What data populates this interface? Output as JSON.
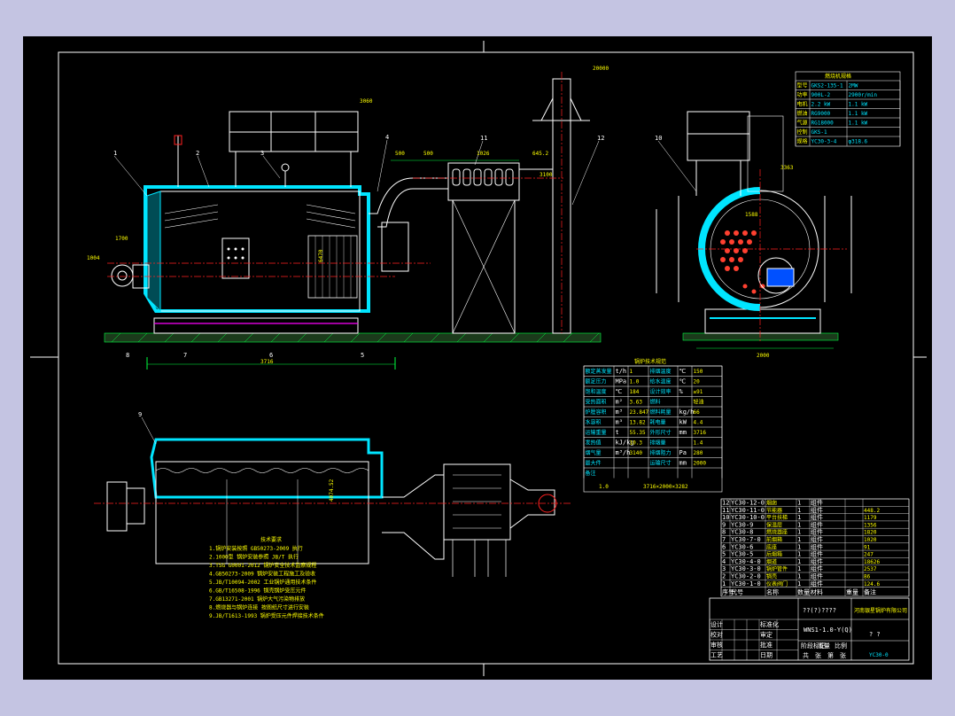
{
  "drawing": {
    "code": "YC30-0",
    "model": "WNS1-1.0-Y(Q)",
    "title_marks": "??(?)????",
    "placeholder_marks": "? ?",
    "company": "河南银星锅炉有限公司"
  },
  "balloons": [
    "1",
    "2",
    "3",
    "4",
    "5",
    "6",
    "7",
    "8",
    "9",
    "10",
    "11",
    "12"
  ],
  "dimensions": {
    "overall_length": "3716",
    "base_width": "2000",
    "chimney_height": "20000",
    "top_height": "3060",
    "burner_height": "1700",
    "inlet_height": "1004",
    "duct_height": "3100",
    "economizer_width": "1026",
    "dim_500a": "500",
    "dim_500b": "500",
    "dim_645": "645.2",
    "side_height": "3363",
    "side_width": "1588",
    "diameter": "6470",
    "plan_dim": "4074.52"
  },
  "tech_notes_title": "技术要求",
  "tech_notes": [
    "1.锅炉安装按照 GB50273-2009 执行",
    "2.1000型 锅炉安装参照 JB/T 执行",
    "3.TSG G0001-2012 锅炉安全技术监察规程",
    "4.GB50273-2009 锅炉安装工程施工及验收",
    "5.JB/T10094-2002 工业锅炉通用技术条件",
    "6.GB/T16508-1996 锅壳锅炉受压元件",
    "7.GB13271-2001 锅炉大气污染物排放",
    "8.燃烧器与锅炉连接 按图纸尺寸进行安装",
    "9.JB/T1613-1993 锅炉受压元件焊接技术条件"
  ],
  "burner_table": {
    "title": "燃烧机规格",
    "rows": [
      [
        "型号",
        "GKS2-135-1",
        "2MW"
      ],
      [
        "功率",
        "900L-2",
        "2900r/min"
      ],
      [
        "电机",
        "2.2 kW",
        "1.1 kW"
      ],
      [
        "燃油",
        "RG9000",
        "1.1 kW"
      ],
      [
        "气源",
        "RG18000",
        "1.1 kW"
      ],
      [
        "控制",
        "GKS-1",
        ""
      ],
      [
        "规格",
        "YC30-3-4",
        "φ318.6"
      ]
    ]
  },
  "tech_table": {
    "title": "锅炉技术规范",
    "rows": [
      [
        "额定蒸发量",
        "t/h",
        "1",
        "排烟温度",
        "℃",
        "150"
      ],
      [
        "额定压力",
        "MPa",
        "1.0",
        "给水温度",
        "℃",
        "20"
      ],
      [
        "饱和温度",
        "℃",
        "184",
        "设计效率",
        "%",
        "≥91"
      ],
      [
        "受热面积",
        "m²",
        "3.63",
        "燃料",
        "",
        "轻油"
      ],
      [
        "炉膛容积",
        "m³",
        "23.847",
        "燃料耗量",
        "kg/h",
        "66"
      ],
      [
        "水容积",
        "m³",
        "13.82",
        "耗电量",
        "kW",
        "4.4"
      ],
      [
        "运输重量",
        "t",
        "55.35",
        "外形尺寸",
        "mm",
        "3716"
      ],
      [
        "发热值",
        "kJ/kg",
        "10.3",
        "排烟量",
        "",
        "1.4"
      ],
      [
        "烟气量",
        "m³/h",
        "3140",
        "排烟阻力",
        "Pa",
        "280"
      ],
      [
        "最大件",
        "",
        "",
        "运输尺寸",
        "mm",
        "2000"
      ],
      [
        "备注",
        "",
        "",
        "",
        "",
        ""
      ]
    ],
    "footer_a": "3716×2000×3282",
    "footer_b": "1.0"
  },
  "parts": [
    [
      "12",
      "YC30-12-0",
      "烟囱",
      "1",
      "组件",
      "",
      ""
    ],
    [
      "11",
      "YC30-11-0",
      "节能器",
      "1",
      "组件",
      "",
      "448.2"
    ],
    [
      "10",
      "YC30-10-0",
      "平台扶梯",
      "1",
      "组件",
      "",
      "1179"
    ],
    [
      "9",
      "YC30-9",
      "保温层",
      "1",
      "组件",
      "",
      "1356"
    ],
    [
      "8",
      "YC30-8",
      "燃烧器座",
      "1",
      "组件",
      "",
      "1820"
    ],
    [
      "7",
      "YC30-7-0",
      "前烟箱",
      "1",
      "组件",
      "",
      "1020"
    ],
    [
      "6",
      "YC30-6",
      "底座",
      "1",
      "组件",
      "",
      "91"
    ],
    [
      "5",
      "YC30-5",
      "后烟箱",
      "1",
      "组件",
      "",
      "247"
    ],
    [
      "4",
      "YC30-4-0",
      "烟道",
      "1",
      "组件",
      "",
      "18626"
    ],
    [
      "3",
      "YC30-3-0",
      "锅炉管件",
      "1",
      "组件",
      "",
      "2537"
    ],
    [
      "2",
      "YC30-2-0",
      "锅壳",
      "1",
      "组件",
      "",
      "86"
    ],
    [
      "1",
      "YC30-1-0",
      "仪表阀门",
      "1",
      "组件",
      "",
      "124.6"
    ]
  ],
  "parts_header": [
    "序号",
    "代号",
    "名称",
    "数量",
    "材料",
    "重量",
    "备注"
  ],
  "title_block_rows": [
    [
      "设计",
      "",
      "",
      "",
      "标准化",
      ""
    ],
    [
      "校对",
      "",
      "",
      "",
      "审定",
      ""
    ],
    [
      "审核",
      "",
      "",
      "",
      "批准",
      ""
    ],
    [
      "工艺",
      "",
      "",
      "",
      "日期",
      ""
    ]
  ],
  "scale_cells": [
    "阶段标记",
    "重量",
    "比例"
  ],
  "sheet_cells": [
    "共",
    "张",
    "第",
    "张"
  ],
  "colors": {
    "background": "#c4c4e2",
    "sheet": "#000000",
    "line": "#ffffff",
    "insulation": "#00e5ff",
    "centerline": "#ff2020",
    "dimension": "#00ff40",
    "highlight": "#ff00ff",
    "text_yellow": "#ffff00"
  }
}
